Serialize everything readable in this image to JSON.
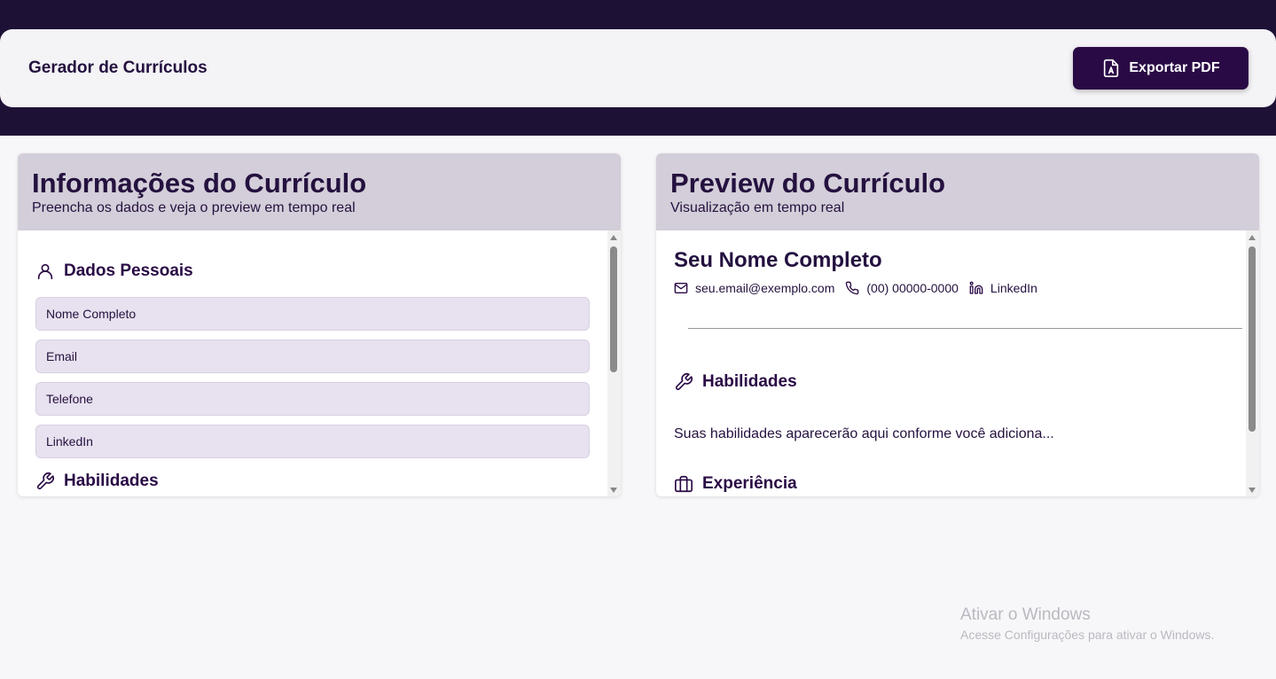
{
  "header": {
    "title": "Gerador de Currículos",
    "export_label": "Exportar PDF",
    "export_icon": "file-pdf-icon"
  },
  "form_panel": {
    "title": "Informações do Currículo",
    "subtitle": "Preencha os dados e veja o preview em tempo real",
    "personal_section": {
      "title": "Dados Pessoais",
      "icon": "user-icon"
    },
    "fields": [
      {
        "placeholder": "Nome Completo",
        "value": ""
      },
      {
        "placeholder": "Email",
        "value": ""
      },
      {
        "placeholder": "Telefone",
        "value": ""
      },
      {
        "placeholder": "LinkedIn",
        "value": ""
      }
    ],
    "skills_section": {
      "title": "Habilidades",
      "icon": "wrench-icon"
    }
  },
  "preview_panel": {
    "title": "Preview do Currículo",
    "subtitle": "Visualização em tempo real",
    "name": "Seu Nome Completo",
    "contacts": {
      "email": "seu.email@exemplo.com",
      "phone": "(00) 00000-0000",
      "linkedin": "LinkedIn"
    },
    "skills_title": "Habilidades",
    "skills_placeholder": "Suas habilidades aparecerão aqui conforme você adiciona...",
    "experience_title": "Experiência"
  },
  "watermark": {
    "title": "Ativar o Windows",
    "subtitle": "Acesse Configurações para ativar o Windows."
  },
  "colors": {
    "primary": "#2a0a45",
    "top_band": "#1e1136",
    "panel_header": "#d3ced9",
    "input_bg": "#e8e1ef"
  }
}
